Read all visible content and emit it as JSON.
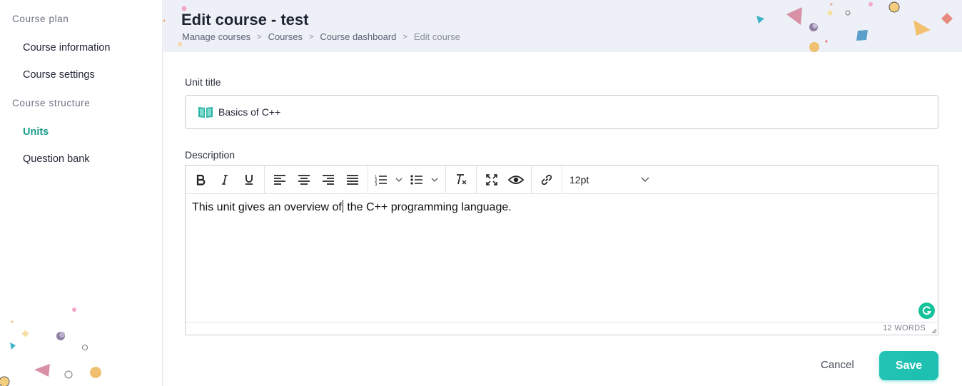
{
  "sidebar": {
    "sections": [
      {
        "title": "Course plan",
        "items": [
          {
            "label": "Course information"
          },
          {
            "label": "Course settings"
          }
        ]
      },
      {
        "title": "Course structure",
        "items": [
          {
            "label": "Units",
            "active": true
          },
          {
            "label": "Question bank"
          }
        ]
      }
    ]
  },
  "header": {
    "title": "Edit course - test",
    "breadcrumb": [
      "Manage courses",
      "Courses",
      "Course dashboard",
      "Edit course"
    ]
  },
  "form": {
    "unit_title": {
      "label": "Unit title",
      "value": "Basics of C++",
      "icon": "open-book-icon"
    },
    "description": {
      "label": "Description",
      "text_before_caret": "This unit gives an overview of",
      "text_after_caret": " the C++ programming language.",
      "font_size": "12pt",
      "word_count": "12 WORDS"
    }
  },
  "actions": {
    "cancel_label": "Cancel",
    "save_label": "Save"
  },
  "colors": {
    "accent": "#1a9e8d",
    "save_button": "#1dbfb0",
    "header_bg": "#eef0f8",
    "grammarly": "#15c39a"
  }
}
